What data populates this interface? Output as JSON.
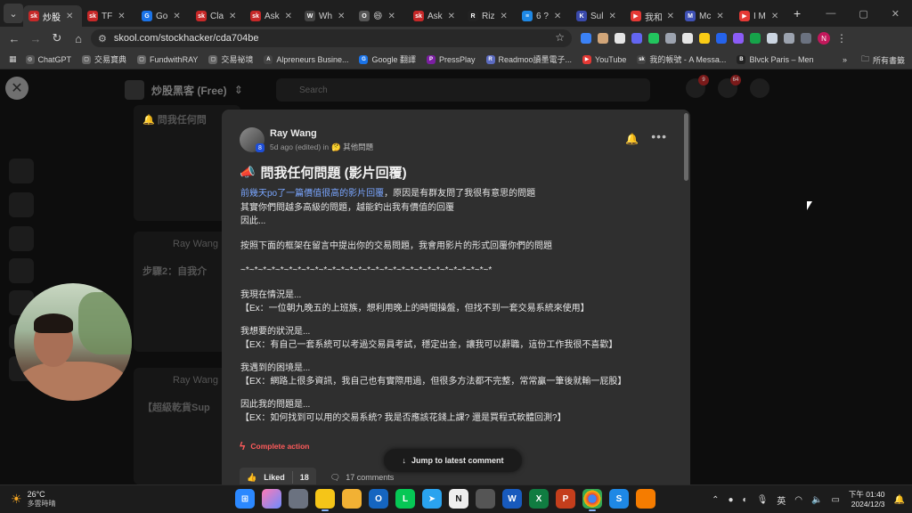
{
  "browser": {
    "tabs": [
      {
        "label": "炒股",
        "fav": "sk",
        "color": "#c62828",
        "active": true
      },
      {
        "label": "TF",
        "fav": "sk",
        "color": "#c62828"
      },
      {
        "label": "Go",
        "fav": "G",
        "color": "#1a73e8"
      },
      {
        "label": "Cla",
        "fav": "sk",
        "color": "#c62828"
      },
      {
        "label": "Ask",
        "fav": "sk",
        "color": "#c62828"
      },
      {
        "label": "Wh",
        "fav": "W",
        "color": "#444"
      },
      {
        "label": "😄",
        "fav": "O",
        "color": "#555"
      },
      {
        "label": "Ask",
        "fav": "sk",
        "color": "#c62828"
      },
      {
        "label": "Riz",
        "fav": "R",
        "color": "#222"
      },
      {
        "label": "6 ?",
        "fav": "≡",
        "color": "#1e88e5"
      },
      {
        "label": "Sul",
        "fav": "K",
        "color": "#3949ab"
      },
      {
        "label": "我和",
        "fav": "▶",
        "color": "#e53935"
      },
      {
        "label": "Mc",
        "fav": "M",
        "color": "#3f51b5"
      },
      {
        "label": "I M",
        "fav": "▶",
        "color": "#e53935"
      }
    ],
    "new_tab": "+",
    "url": "skool.com/stockhacker/cda704be",
    "bookmarks": [
      {
        "label": "ChatGPT",
        "fav": "◎",
        "color": "#555"
      },
      {
        "label": "交易寶典",
        "fav": "▢",
        "color": "#666"
      },
      {
        "label": "FundwithRAY",
        "fav": "▢",
        "color": "#666"
      },
      {
        "label": "交易祕境",
        "fav": "▢",
        "color": "#666"
      },
      {
        "label": "Alpreneurs Busine...",
        "fav": "A",
        "color": "#444"
      },
      {
        "label": "Google 翻譯",
        "fav": "G",
        "color": "#1a73e8"
      },
      {
        "label": "PressPlay",
        "fav": "P",
        "color": "#7b1fa2"
      },
      {
        "label": "Readmoo讀墨電子...",
        "fav": "R",
        "color": "#5c6bc0"
      },
      {
        "label": "YouTube",
        "fav": "▶",
        "color": "#e53935"
      },
      {
        "label": "我的帳號 - A Messa...",
        "fav": "sk",
        "color": "#444"
      },
      {
        "label": "Blvck Paris – Men",
        "fav": "B",
        "color": "#222"
      }
    ],
    "bookmarks_more": "»",
    "all_bookmarks": "所有書籤",
    "profile_letter": "N"
  },
  "background": {
    "group_name": "炒股黑客 (Free)",
    "search_placeholder": "Search",
    "badge_1": "9",
    "badge_2": "64",
    "card1_title": "🔔 問我任何問",
    "card2_author": "Ray Wang",
    "card2_title": "步驟2：自我介",
    "card3_author": "Ray Wang",
    "card3_title": "【超級乾貨Sup"
  },
  "post": {
    "author": "Ray Wang",
    "badge_level": "8",
    "time": "5d ago (edited) in",
    "category": "🤔 其他問題",
    "title": "問我任何問題 (影片回覆)",
    "line1_link": "前幾天po了一篇價值很高的影片回覆",
    "line1_rest": "，原因是有群友問了我很有意思的問題",
    "line2": "其實你們問越多高級的問題，越能釣出我有價值的回覆",
    "line3": "因此...",
    "line4": "按照下面的框架在留言中提出你的交易問題，我會用影片的形式回覆你們的問題",
    "line5": "~*~*~*~*~*~*~*~*~*~*~*~*~*~*~*~*~*~*~*~*~*~*~*~*~*~*~*~*~*",
    "line6": "我現在情況是...",
    "line7": "【Ex：一位朝九晚五的上班族，想利用晚上的時間操盤，但找不到一套交易系統來使用】",
    "line8": "我想要的狀況是...",
    "line9": "【EX：有自己一套系統可以考過交易員考試，穩定出金，讓我可以辭職，這份工作我很不喜歡】",
    "line10": "我遇到的困境是...",
    "line11": "【EX：網路上很多資訊，我自己也有實際用過，但很多方法都不完整，常常贏一筆後就輸一屁股】",
    "line12": "因此我的問題是...",
    "line13": "【EX：如何找到可以用的交易系統? 我是否應該花錢上課? 還是買程式軟體回測?】",
    "complete_action": "Complete action",
    "jump_label": "Jump to latest comment",
    "liked_label": "Liked",
    "like_count": "18",
    "comments_label": "17 comments"
  },
  "taskbar": {
    "temp": "26°C",
    "weather": "多雲時晴",
    "ime": "英",
    "time": "下午 01:40",
    "date": "2024/12/3"
  }
}
